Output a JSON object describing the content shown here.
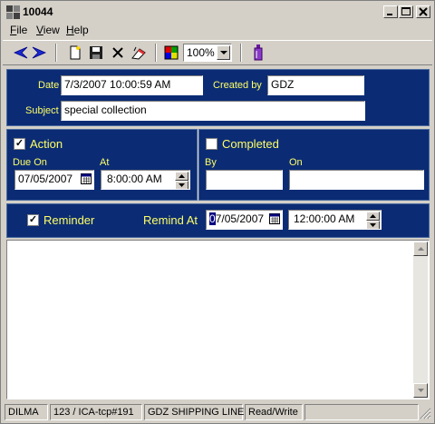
{
  "window": {
    "title": "10044"
  },
  "menu": {
    "file": {
      "accel": "F",
      "rest": "ile"
    },
    "view": {
      "accel": "V",
      "rest": "iew"
    },
    "help": {
      "accel": "H",
      "rest": "elp"
    }
  },
  "toolbar": {
    "zoom": "100%"
  },
  "header": {
    "date_label": "Date",
    "date_value": "7/3/2007 10:00:59 AM",
    "created_by_label": "Created by",
    "created_by_value": "GDZ",
    "subject_label": "Subject",
    "subject_value": "special collection"
  },
  "action": {
    "label": "Action",
    "checked": true,
    "due_on_label": "Due On",
    "due_on_value": "07/05/2007",
    "at_label": "At",
    "at_value": "8:00:00 AM"
  },
  "completed": {
    "label": "Completed",
    "checked": false,
    "by_label": "By",
    "by_value": "",
    "on_label": "On",
    "on_value": ""
  },
  "reminder": {
    "label": "Reminder",
    "checked": true,
    "remind_at_label": "Remind At",
    "date_first_digit": "0",
    "date_rest": "7/05/2007",
    "time_value": "12:00:00 AM"
  },
  "notes": {
    "value": ""
  },
  "status": {
    "user": "DILMA",
    "reference": "123 / ICA-tcp#191",
    "company": "GDZ SHIPPING LINE",
    "mode": "Read/Write"
  },
  "colors": {
    "panel_bg": "#0b2c74",
    "label_yellow": "#ffff66",
    "chrome": "#d4d0c8"
  }
}
